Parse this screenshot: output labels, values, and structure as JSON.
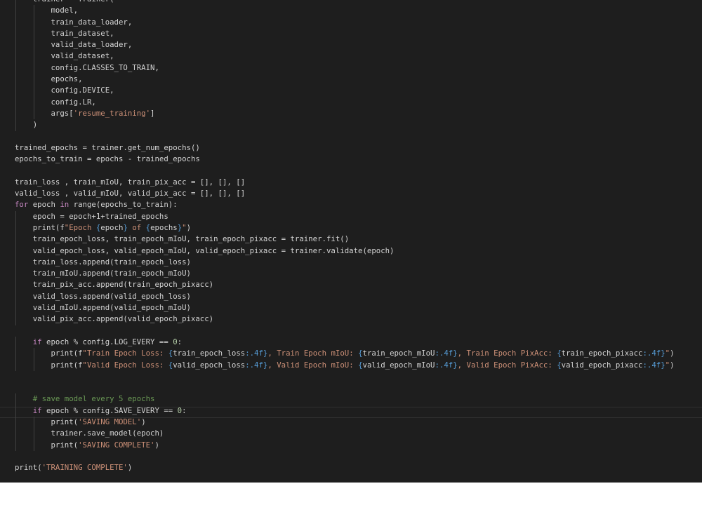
{
  "editor": {
    "background": "#1e1e1e",
    "colors": {
      "keyword": "#c586c0",
      "string": "#ce9178",
      "number": "#b5cea8",
      "comment": "#6a9955",
      "function": "#dcdcaa",
      "text": "#d4d4d4",
      "brace": "#569cd6"
    },
    "lines": [
      [
        {
          "t": "    trainer = Trainer(",
          "c": "pl"
        }
      ],
      [
        {
          "t": "        model,",
          "c": "pl"
        }
      ],
      [
        {
          "t": "        train_data_loader,",
          "c": "pl"
        }
      ],
      [
        {
          "t": "        train_dataset,",
          "c": "pl"
        }
      ],
      [
        {
          "t": "        valid_data_loader,",
          "c": "pl"
        }
      ],
      [
        {
          "t": "        valid_dataset,",
          "c": "pl"
        }
      ],
      [
        {
          "t": "        config.CLASSES_TO_TRAIN,",
          "c": "pl"
        }
      ],
      [
        {
          "t": "        epochs,",
          "c": "pl"
        }
      ],
      [
        {
          "t": "        config.DEVICE,",
          "c": "pl"
        }
      ],
      [
        {
          "t": "        config.LR,",
          "c": "pl"
        }
      ],
      [
        {
          "t": "        args[",
          "c": "pl"
        },
        {
          "t": "'resume_training'",
          "c": "str"
        },
        {
          "t": "]",
          "c": "pl"
        }
      ],
      [
        {
          "t": "    )",
          "c": "pl"
        }
      ],
      [],
      [
        {
          "t": "trained_epochs = trainer.get_num_epochs()",
          "c": "pl"
        }
      ],
      [
        {
          "t": "epochs_to_train = epochs - trained_epochs",
          "c": "pl"
        }
      ],
      [],
      [
        {
          "t": "train_loss , train_mIoU, train_pix_acc = [], [], []",
          "c": "pl"
        }
      ],
      [
        {
          "t": "valid_loss , valid_mIoU, valid_pix_acc = [], [], []",
          "c": "pl"
        }
      ],
      [
        {
          "t": "for",
          "c": "kw"
        },
        {
          "t": " epoch ",
          "c": "pl"
        },
        {
          "t": "in",
          "c": "kw"
        },
        {
          "t": " range(epochs_to_train):",
          "c": "pl"
        }
      ],
      [
        {
          "t": "    epoch = epoch+1+trained_epochs",
          "c": "pl"
        }
      ],
      [
        {
          "t": "    print(f",
          "c": "pl"
        },
        {
          "t": "\"Epoch ",
          "c": "str"
        },
        {
          "t": "{",
          "c": "br"
        },
        {
          "t": "epoch",
          "c": "pl"
        },
        {
          "t": "}",
          "c": "br"
        },
        {
          "t": " of ",
          "c": "str"
        },
        {
          "t": "{",
          "c": "br"
        },
        {
          "t": "epochs",
          "c": "pl"
        },
        {
          "t": "}",
          "c": "br"
        },
        {
          "t": "\"",
          "c": "str"
        },
        {
          "t": ")",
          "c": "pl"
        }
      ],
      [
        {
          "t": "    train_epoch_loss, train_epoch_mIoU, train_epoch_pixacc = trainer.fit()",
          "c": "pl"
        }
      ],
      [
        {
          "t": "    valid_epoch_loss, valid_epoch_mIoU, valid_epoch_pixacc = trainer.validate(epoch)",
          "c": "pl"
        }
      ],
      [
        {
          "t": "    train_loss.append(train_epoch_loss)",
          "c": "pl"
        }
      ],
      [
        {
          "t": "    train_mIoU.append(train_epoch_mIoU)",
          "c": "pl"
        }
      ],
      [
        {
          "t": "    train_pix_acc.append(train_epoch_pixacc)",
          "c": "pl"
        }
      ],
      [
        {
          "t": "    valid_loss.append(valid_epoch_loss)",
          "c": "pl"
        }
      ],
      [
        {
          "t": "    valid_mIoU.append(valid_epoch_mIoU)",
          "c": "pl"
        }
      ],
      [
        {
          "t": "    valid_pix_acc.append(valid_epoch_pixacc)",
          "c": "pl"
        }
      ],
      [],
      [
        {
          "t": "    ",
          "c": "pl"
        },
        {
          "t": "if",
          "c": "kw"
        },
        {
          "t": " epoch % config.LOG_EVERY == ",
          "c": "pl"
        },
        {
          "t": "0",
          "c": "num"
        },
        {
          "t": ":",
          "c": "pl"
        }
      ],
      [
        {
          "t": "        print(f",
          "c": "pl"
        },
        {
          "t": "\"Train Epoch Loss: ",
          "c": "str"
        },
        {
          "t": "{",
          "c": "br"
        },
        {
          "t": "train_epoch_loss",
          "c": "pl"
        },
        {
          "t": ":.4f}",
          "c": "br"
        },
        {
          "t": ", Train Epoch mIoU: ",
          "c": "str"
        },
        {
          "t": "{",
          "c": "br"
        },
        {
          "t": "train_epoch_mIoU",
          "c": "pl"
        },
        {
          "t": ":.4f}",
          "c": "br"
        },
        {
          "t": ", Train Epoch PixAcc: ",
          "c": "str"
        },
        {
          "t": "{",
          "c": "br"
        },
        {
          "t": "train_epoch_pixacc",
          "c": "pl"
        },
        {
          "t": ":.4f}",
          "c": "br"
        },
        {
          "t": "\"",
          "c": "str"
        },
        {
          "t": ")",
          "c": "pl"
        }
      ],
      [
        {
          "t": "        print(f",
          "c": "pl"
        },
        {
          "t": "\"Valid Epoch Loss: ",
          "c": "str"
        },
        {
          "t": "{",
          "c": "br"
        },
        {
          "t": "valid_epoch_loss",
          "c": "pl"
        },
        {
          "t": ":.4f}",
          "c": "br"
        },
        {
          "t": ", Valid Epoch mIoU: ",
          "c": "str"
        },
        {
          "t": "{",
          "c": "br"
        },
        {
          "t": "valid_epoch_mIoU",
          "c": "pl"
        },
        {
          "t": ":.4f}",
          "c": "br"
        },
        {
          "t": ", Valid Epoch PixAcc: ",
          "c": "str"
        },
        {
          "t": "{",
          "c": "br"
        },
        {
          "t": "valid_epoch_pixacc",
          "c": "pl"
        },
        {
          "t": ":.4f}",
          "c": "br"
        },
        {
          "t": "\"",
          "c": "str"
        },
        {
          "t": ")",
          "c": "pl"
        }
      ],
      [],
      [],
      [
        {
          "t": "    # save model every 5 epochs",
          "c": "cm"
        }
      ],
      [
        {
          "t": "    ",
          "c": "pl"
        },
        {
          "t": "if",
          "c": "kw"
        },
        {
          "t": " epoch % config.SAVE_EVERY == ",
          "c": "pl"
        },
        {
          "t": "0",
          "c": "num"
        },
        {
          "t": ":",
          "c": "pl"
        }
      ],
      [
        {
          "t": "        print(",
          "c": "pl"
        },
        {
          "t": "'SAVING MODEL'",
          "c": "str"
        },
        {
          "t": ")",
          "c": "pl"
        }
      ],
      [
        {
          "t": "        trainer.save_model(epoch)",
          "c": "pl"
        }
      ],
      [
        {
          "t": "        print(",
          "c": "pl"
        },
        {
          "t": "'SAVING COMPLETE'",
          "c": "str"
        },
        {
          "t": ")",
          "c": "pl"
        }
      ],
      [],
      [
        {
          "t": "print(",
          "c": "pl"
        },
        {
          "t": "'TRAINING COMPLETE'",
          "c": "str"
        },
        {
          "t": ")",
          "c": "pl"
        }
      ]
    ]
  }
}
